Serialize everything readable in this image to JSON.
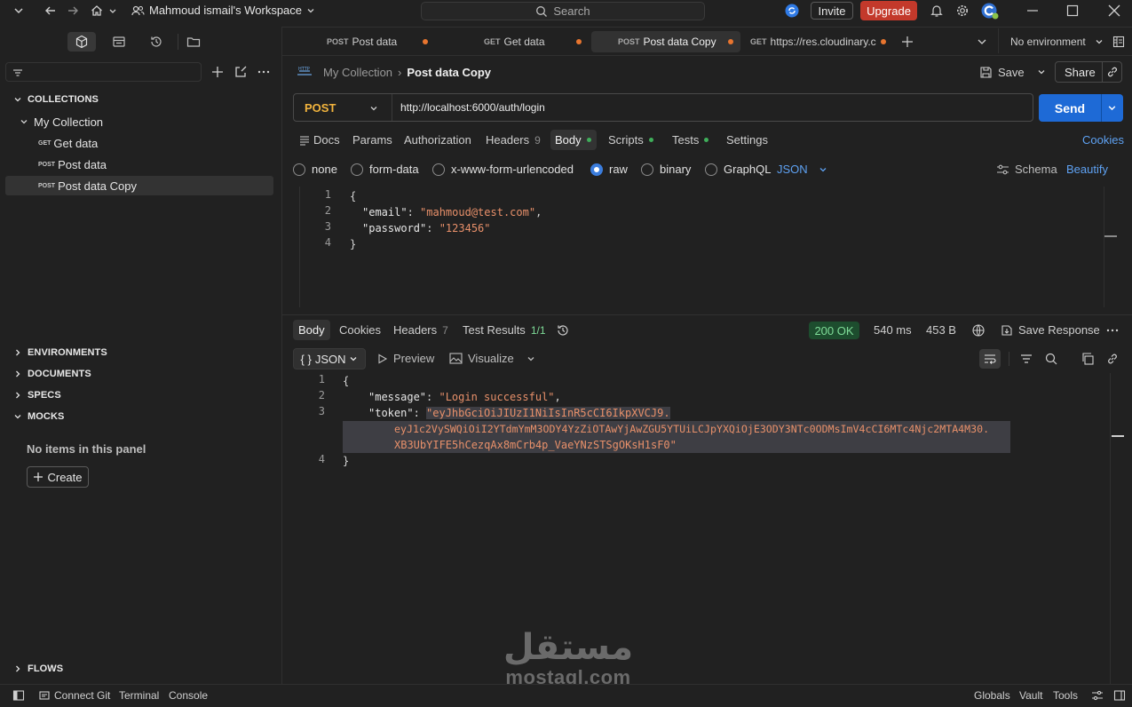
{
  "topbar": {
    "workspace": "Mahmoud ismail's Workspace",
    "search_placeholder": "Search",
    "invite": "Invite",
    "upgrade": "Upgrade"
  },
  "sidebar": {
    "collections_header": "COLLECTIONS",
    "collection_name": "My Collection",
    "requests": [
      {
        "method": "GET",
        "name": "Get data"
      },
      {
        "method": "POST",
        "name": "Post data"
      },
      {
        "method": "POST",
        "name": "Post data Copy"
      }
    ],
    "sections": [
      "ENVIRONMENTS",
      "DOCUMENTS",
      "SPECS",
      "MOCKS"
    ],
    "empty_text": "No items in this panel",
    "create": "Create",
    "flows": "FLOWS"
  },
  "tabs": [
    {
      "method": "POST",
      "name": "Post data"
    },
    {
      "method": "GET",
      "name": "Get data"
    },
    {
      "method": "POST",
      "name": "Post data Copy"
    },
    {
      "method": "GET",
      "name": "https://res.cloudinary.c"
    }
  ],
  "environment": "No environment",
  "breadcrumb": {
    "collection": "My Collection",
    "request": "Post data Copy"
  },
  "actions": {
    "save": "Save",
    "share": "Share"
  },
  "request": {
    "method": "POST",
    "url": "http://localhost:6000/auth/login",
    "send": "Send",
    "tabs": {
      "docs": "Docs",
      "params": "Params",
      "authorization": "Authorization",
      "headers": "Headers",
      "headers_count": "9",
      "body": "Body",
      "scripts": "Scripts",
      "tests": "Tests",
      "settings": "Settings"
    },
    "cookies": "Cookies",
    "body_options": {
      "none": "none",
      "form_data": "form-data",
      "urlencoded": "x-www-form-urlencoded",
      "raw": "raw",
      "binary": "binary",
      "graphql": "GraphQL",
      "json": "JSON"
    },
    "schema": "Schema",
    "beautify": "Beautify",
    "body_lines": [
      {
        "n": "1",
        "text": "{"
      },
      {
        "n": "2",
        "key": "\"email\"",
        "value": "\"mahmoud@test.com\"",
        "tail": ","
      },
      {
        "n": "3",
        "key": "\"password\"",
        "value": "\"123456\"",
        "tail": ""
      },
      {
        "n": "4",
        "text": "}"
      }
    ]
  },
  "response": {
    "tabs": {
      "body": "Body",
      "cookies": "Cookies",
      "headers": "Headers",
      "headers_count": "7",
      "test_results": "Test Results",
      "test_count": "1/1"
    },
    "status": "200 OK",
    "time": "540 ms",
    "size": "453 B",
    "save_response": "Save Response",
    "format": "JSON",
    "preview": "Preview",
    "visualize": "Visualize",
    "ln": [
      "1",
      "2",
      "3",
      "4"
    ],
    "open_brace": "{",
    "close_brace": "}",
    "message_key": "\"message\"",
    "message_value": "\"Login successful\"",
    "token_key": "\"token\"",
    "token_line1": "\"eyJhbGciOiJIUzI1NiIsInR5cCI6IkpXVCJ9.",
    "token_line2": "eyJ1c2VySWQiOiI2YTdmYmM3ODY4YzZiOTAwYjAwZGU5YTUiLCJpYXQiOjE3ODY3NTc0ODMsImV4cCI6MTc4Njc2MTA4M30.",
    "token_line3": "XB3UbYIFE5hCezqAx8mCrb4p_VaeYNzSTSgOKsH1sF0\""
  },
  "statusbar": {
    "connect_git": "Connect Git",
    "terminal": "Terminal",
    "console": "Console",
    "globals": "Globals",
    "vault": "Vault",
    "tools": "Tools"
  },
  "watermark": {
    "arabic": "مستقل",
    "latin": "mostaql.com"
  }
}
